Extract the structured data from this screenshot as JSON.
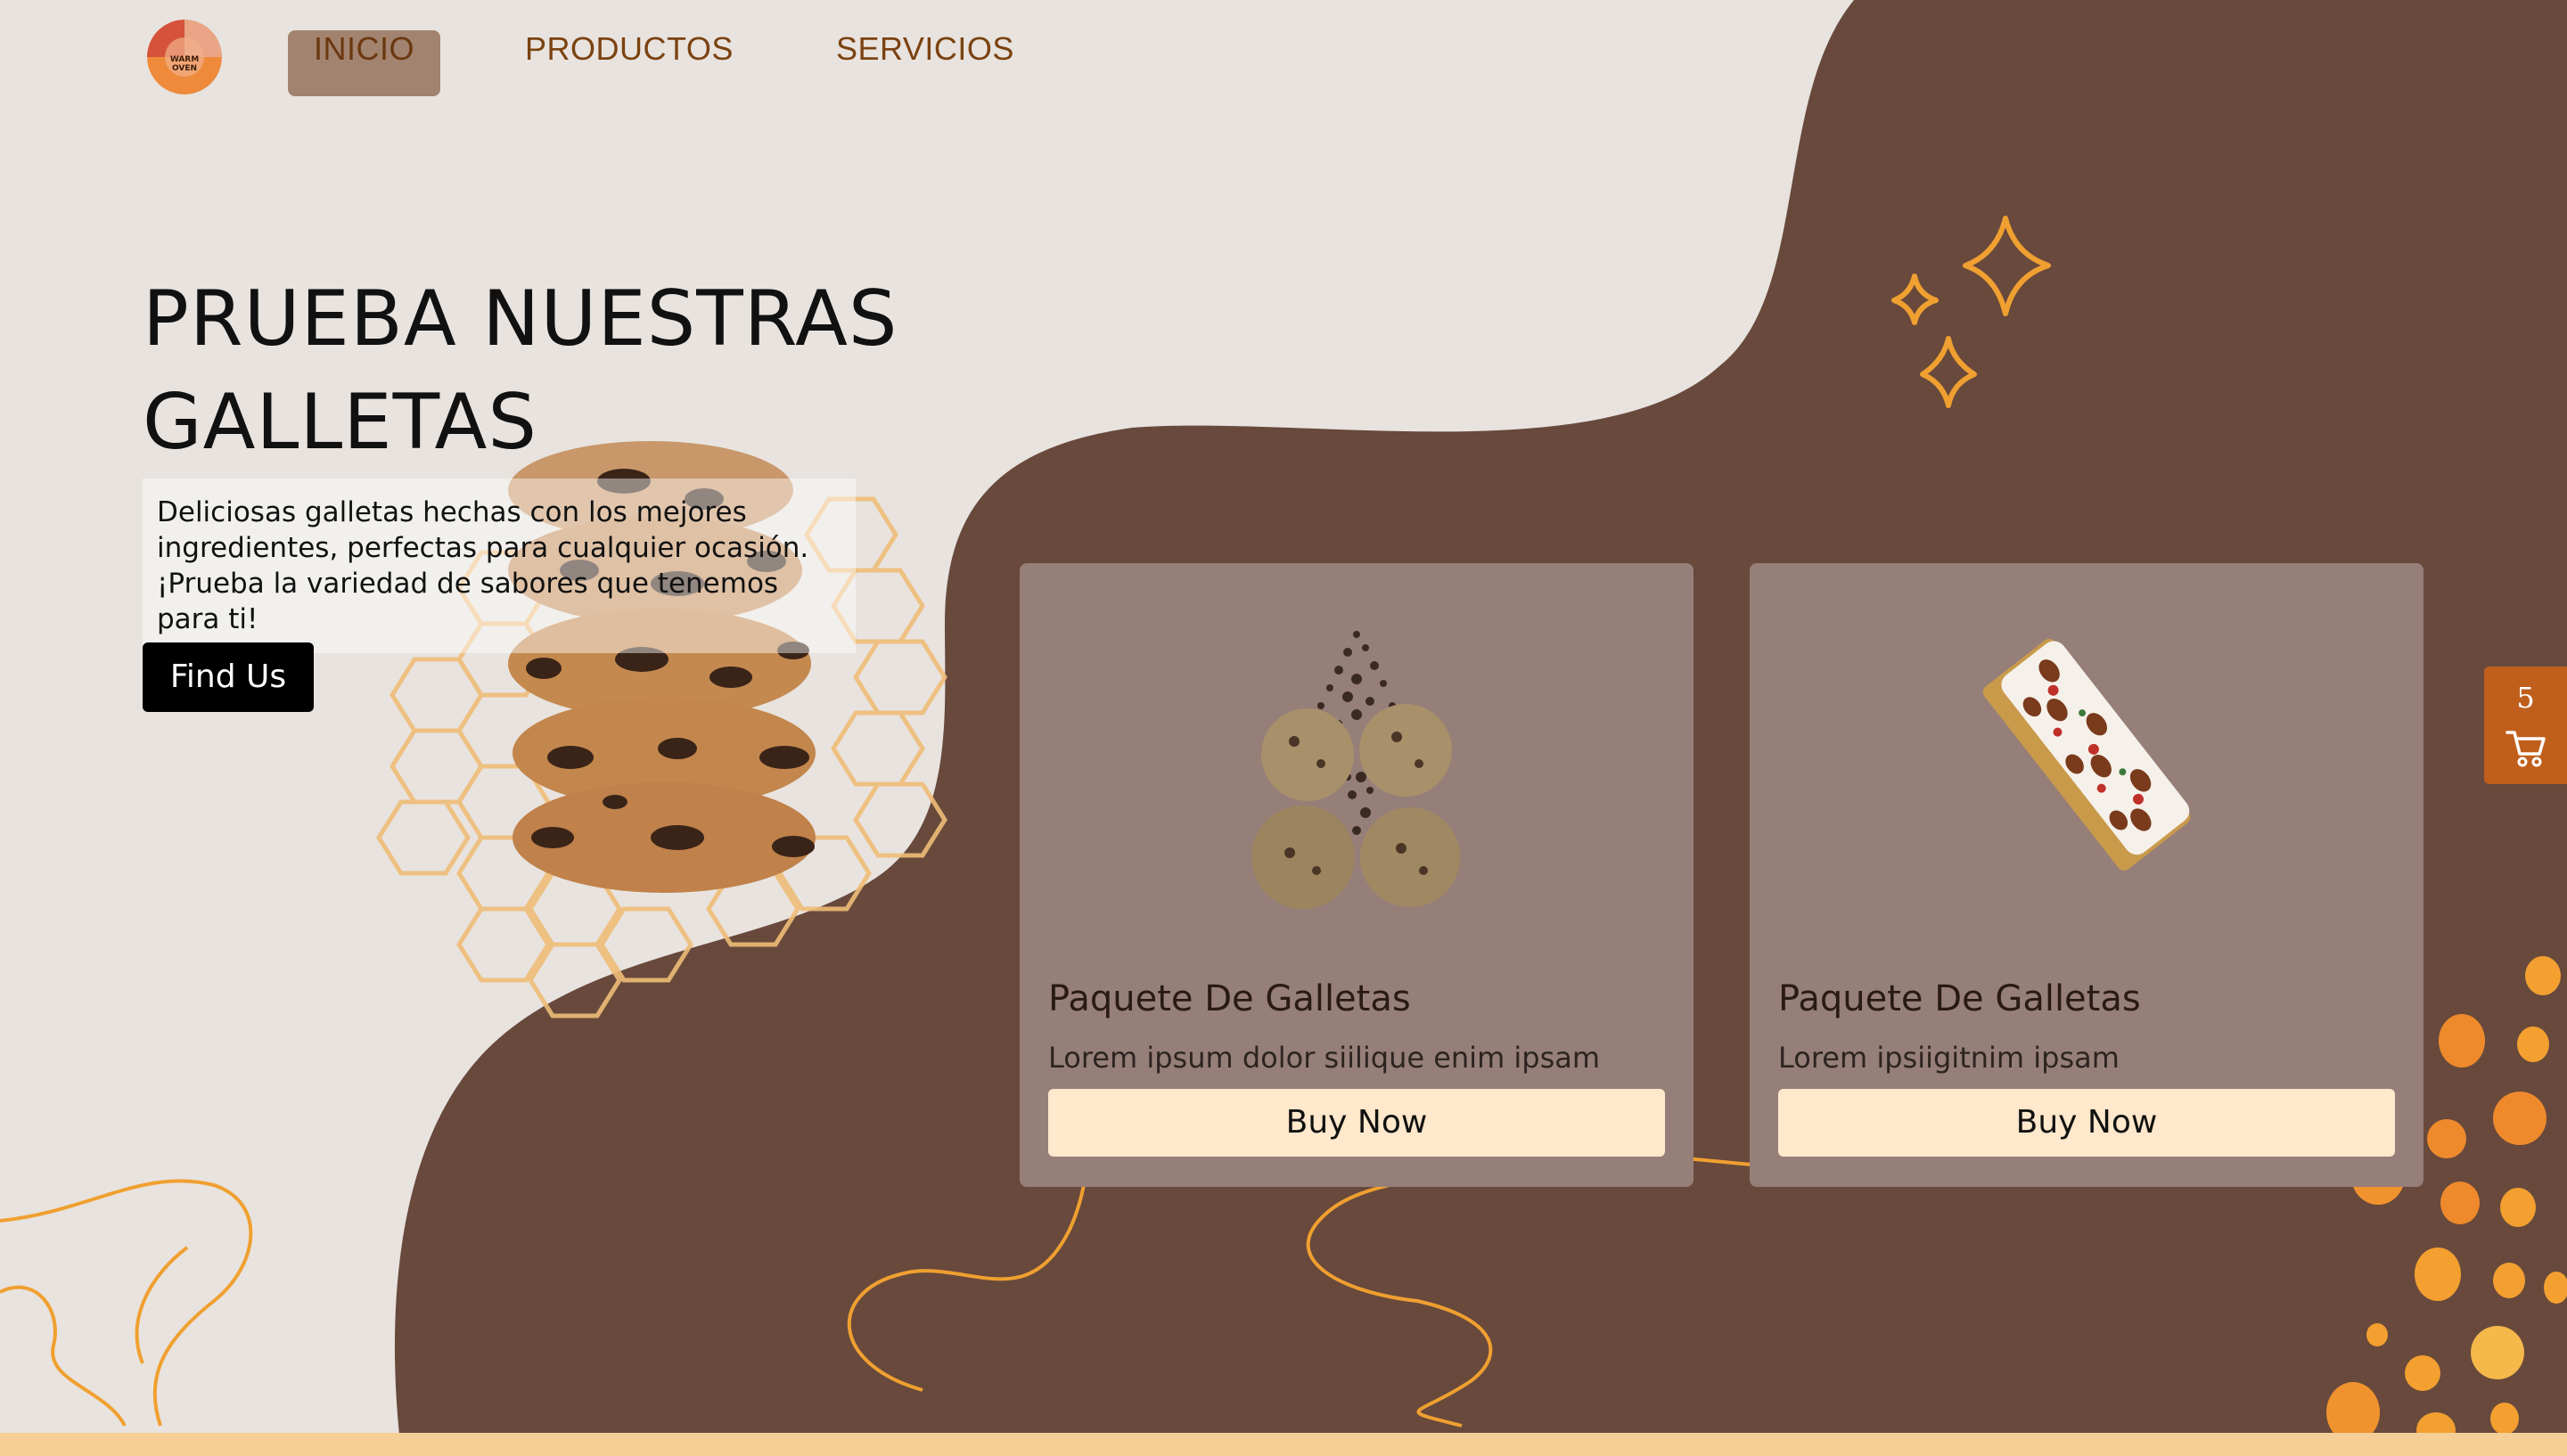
{
  "nav": {
    "logo_text_line1": "WARM",
    "logo_text_line2": "OVEN",
    "items": [
      {
        "label": "INICIO",
        "active": true
      },
      {
        "label": "PRODUCTOS",
        "active": false
      },
      {
        "label": "SERVICIOS",
        "active": false
      }
    ]
  },
  "hero": {
    "title_line1": "PRUEBA NUESTRAS",
    "title_line2": "GALLETAS",
    "description_line1": "Deliciosas galletas hechas con los mejores",
    "description_line2": "ingredientes, perfectas para cualquier ocasión.",
    "description_line3": "¡Prueba la variedad de sabores que tenemos para ti!",
    "cta_label": "Find Us"
  },
  "products": [
    {
      "title": "Paquete De Galletas",
      "description": "Lorem ipsum dolor siilique enim ipsam",
      "button_label": "Buy Now",
      "image": "chocolate-chip-cookies-icon"
    },
    {
      "title": "Paquete De Galletas",
      "description": "Lorem ipsiigitnim ipsam",
      "button_label": "Buy Now",
      "image": "pecan-cake-bar-icon"
    }
  ],
  "cart": {
    "count": "5",
    "icon": "shopping-cart-icon"
  },
  "colors": {
    "background": "#e8e3df",
    "blob": "#68493c",
    "card": "#967f79",
    "button_cream": "#ffe8cb",
    "accent_orange": "#f0a030",
    "nav_text": "#7b4210",
    "nav_active_bg": "#a2836f",
    "cart_bg": "#c05f1c",
    "footer_strip": "#f5cf95"
  }
}
